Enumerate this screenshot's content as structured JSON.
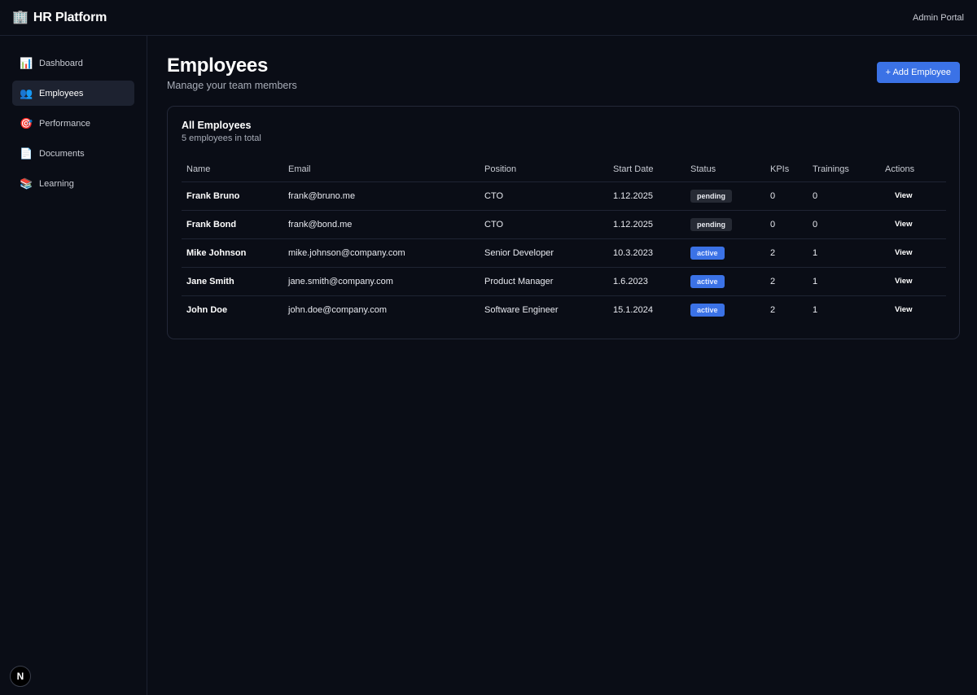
{
  "app": {
    "icon": "building-icon",
    "title": "HR Platform",
    "portal_label": "Admin Portal"
  },
  "sidebar": {
    "items": [
      {
        "icon": "chart-icon",
        "glyph": "📊",
        "label": "Dashboard",
        "active": false
      },
      {
        "icon": "people-icon",
        "glyph": "👥",
        "label": "Employees",
        "active": true
      },
      {
        "icon": "target-icon",
        "glyph": "🎯",
        "label": "Performance",
        "active": false
      },
      {
        "icon": "document-icon",
        "glyph": "📄",
        "label": "Documents",
        "active": false
      },
      {
        "icon": "books-icon",
        "glyph": "📚",
        "label": "Learning",
        "active": false
      }
    ]
  },
  "page": {
    "title": "Employees",
    "subtitle": "Manage your team members",
    "add_button": "+ Add Employee"
  },
  "card": {
    "title": "All Employees",
    "subtitle": "5 employees in total"
  },
  "table": {
    "columns": [
      "Name",
      "Email",
      "Position",
      "Start Date",
      "Status",
      "KPIs",
      "Trainings",
      "Actions"
    ],
    "rows": [
      {
        "name": "Frank Bruno",
        "email": "frank@bruno.me",
        "position": "CTO",
        "start_date": "1.12.2025",
        "status": "pending",
        "kpis": "0",
        "trainings": "0",
        "action": "View"
      },
      {
        "name": "Frank Bond",
        "email": "frank@bond.me",
        "position": "CTO",
        "start_date": "1.12.2025",
        "status": "pending",
        "kpis": "0",
        "trainings": "0",
        "action": "View"
      },
      {
        "name": "Mike Johnson",
        "email": "mike.johnson@company.com",
        "position": "Senior Developer",
        "start_date": "10.3.2023",
        "status": "active",
        "kpis": "2",
        "trainings": "1",
        "action": "View"
      },
      {
        "name": "Jane Smith",
        "email": "jane.smith@company.com",
        "position": "Product Manager",
        "start_date": "1.6.2023",
        "status": "active",
        "kpis": "2",
        "trainings": "1",
        "action": "View"
      },
      {
        "name": "John Doe",
        "email": "john.doe@company.com",
        "position": "Software Engineer",
        "start_date": "15.1.2024",
        "status": "active",
        "kpis": "2",
        "trainings": "1",
        "action": "View"
      }
    ]
  },
  "footer": {
    "logo_letter": "N"
  },
  "colors": {
    "accent": "#3b72e6",
    "background": "#0a0d16",
    "pending_badge": "#262a34"
  }
}
